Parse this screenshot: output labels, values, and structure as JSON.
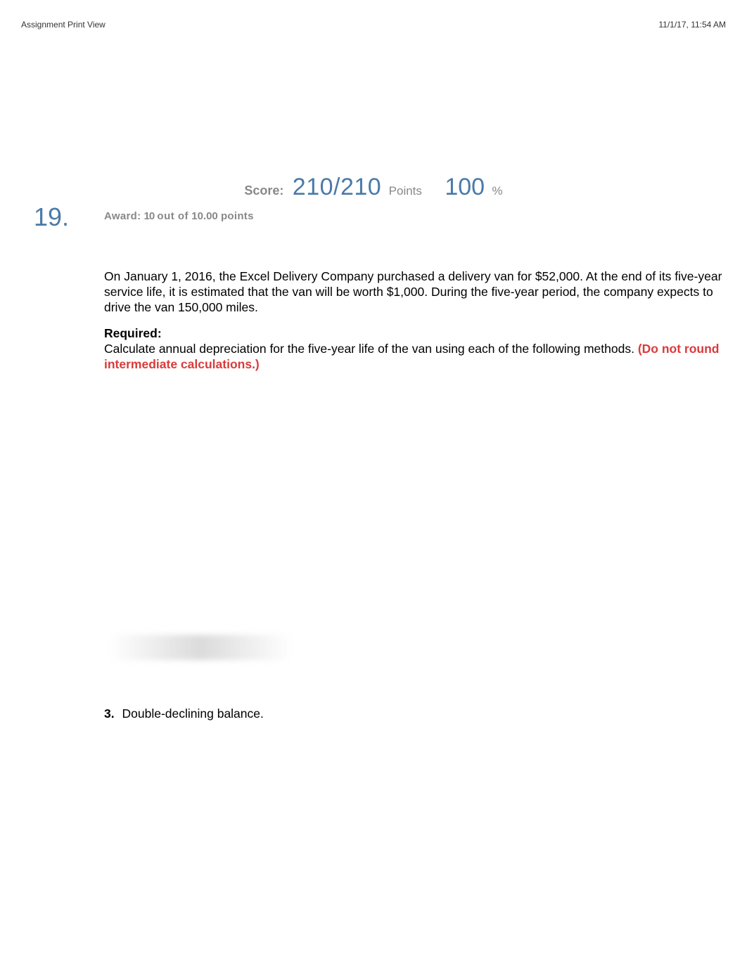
{
  "header": {
    "left": "Assignment Print View",
    "right": "11/1/17, 11:54 AM"
  },
  "score": {
    "label": "Score:",
    "value": "210/210",
    "points_label": "Points",
    "percent": "100",
    "percent_label": "%"
  },
  "question": {
    "number": "19.",
    "award_label": "Award:",
    "award_earned": "10",
    "award_outof": "out of",
    "award_total": "10.00",
    "award_points": "points"
  },
  "body": {
    "paragraph": "On January 1, 2016, the Excel Delivery Company purchased a delivery van for $52,000. At the end of its five-year service life, it is estimated that the van will be worth $1,000. During the five-year period, the company expects to drive the van 150,000 miles."
  },
  "required": {
    "label": "Required:",
    "text": "Calculate annual depreciation for the five-year life of the van using each of the following methods.",
    "red": "(Do not round intermediate calculations.)"
  },
  "q3": {
    "number": "3.",
    "text": "Double-declining balance."
  }
}
